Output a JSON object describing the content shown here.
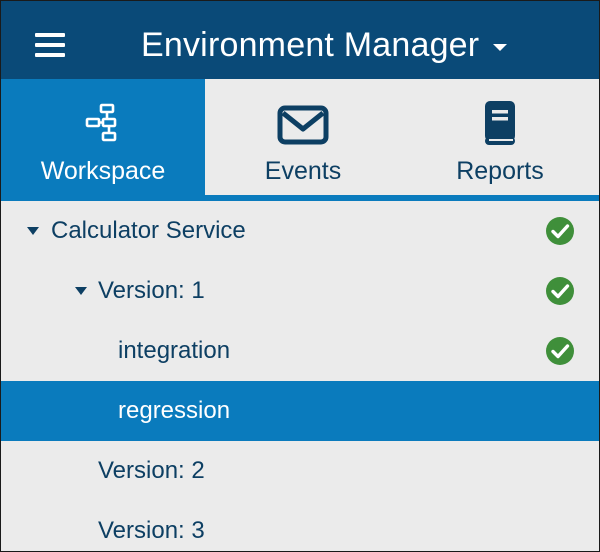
{
  "header": {
    "title": "Environment Manager",
    "background": "#0a4a78",
    "menu_icon": "hamburger-icon"
  },
  "tabs": [
    {
      "label": "Workspace",
      "icon": "workspace-tree-icon",
      "active": true
    },
    {
      "label": "Events",
      "icon": "envelope-icon",
      "active": false
    },
    {
      "label": "Reports",
      "icon": "book-icon",
      "active": false
    }
  ],
  "tree": {
    "items": [
      {
        "label": "Calculator Service",
        "level": 0,
        "expanded": true,
        "status": "ok"
      },
      {
        "label": "Version: 1",
        "level": 1,
        "expanded": true,
        "status": "ok"
      },
      {
        "label": "integration",
        "level": 2,
        "status": "ok"
      },
      {
        "label": "regression",
        "level": 2,
        "selected": true
      },
      {
        "label": "Version: 2",
        "level": 1
      },
      {
        "label": "Version: 3",
        "level": 1
      }
    ]
  },
  "colors": {
    "accent": "#0a7bbd",
    "header": "#0a4a78",
    "text": "#0d3f63",
    "status_ok": "#3f8f3a",
    "background": "#ebebeb"
  }
}
